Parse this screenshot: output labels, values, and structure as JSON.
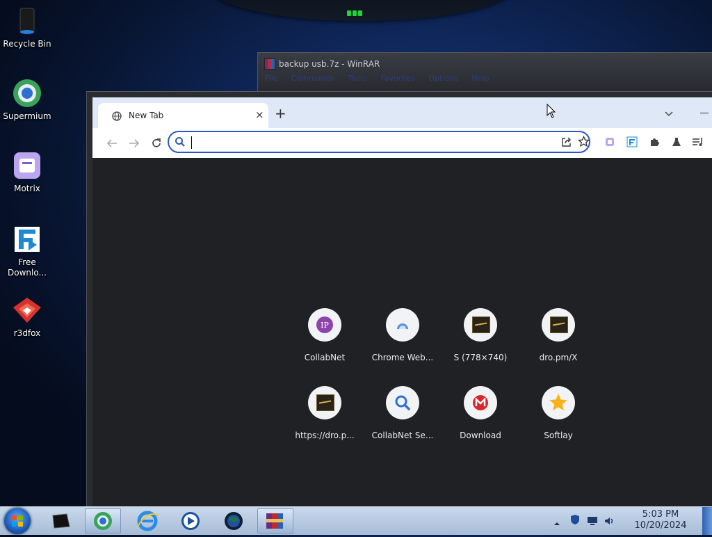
{
  "desktop": {
    "icons": [
      {
        "label": "Recycle Bin"
      },
      {
        "label": "Supermium"
      },
      {
        "label": "Motrix"
      },
      {
        "label": "Free Downlo..."
      },
      {
        "label": "r3dfox"
      }
    ]
  },
  "winrar": {
    "title": "backup usb.7z - WinRAR",
    "menu": [
      "File",
      "Commands",
      "Tools",
      "Favorites",
      "Options",
      "Help"
    ]
  },
  "browser": {
    "tab": {
      "title": "New Tab"
    },
    "new_tab_symbol": "+",
    "tab_close_symbol": "×",
    "omnibox": {
      "value": ""
    },
    "shortcuts": [
      {
        "label": "CollabNet",
        "icon": "ip-icon"
      },
      {
        "label": "Chrome Web...",
        "icon": "chrome-webstore-icon"
      },
      {
        "label": "S (778×740)",
        "icon": "thumbnail-icon"
      },
      {
        "label": "dro.pm/X",
        "icon": "thumbnail-icon"
      },
      {
        "label": "https://dro.p...",
        "icon": "thumbnail-icon"
      },
      {
        "label": "CollabNet Se...",
        "icon": "search-icon"
      },
      {
        "label": "Download",
        "icon": "mega-icon"
      },
      {
        "label": "Softlay",
        "icon": "star-icon"
      }
    ]
  },
  "taskbar": {
    "clock": {
      "time": "5:03 PM",
      "date": "10/20/2024"
    }
  },
  "colors": {
    "omnibox_border": "#2b57c7",
    "ntp_background": "#202124",
    "tabstrip": "#dee8f7"
  }
}
